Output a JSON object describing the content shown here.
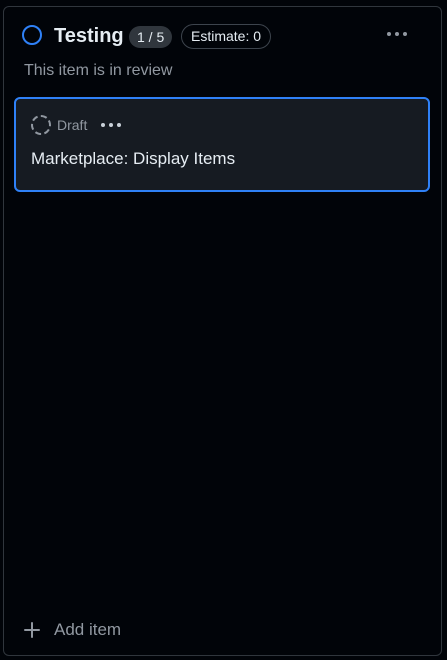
{
  "column": {
    "title": "Testing",
    "count": "1 / 5",
    "estimate": "Estimate: 0",
    "description": "This item is in review",
    "status_icon": "circle-open-icon",
    "accent_color": "#2f81f7"
  },
  "cards": [
    {
      "type_label": "Draft",
      "type_icon": "draft-dashed-circle-icon",
      "title": "Marketplace: Display Items"
    }
  ],
  "footer": {
    "add_item_label": "Add item",
    "add_icon": "plus-icon"
  }
}
